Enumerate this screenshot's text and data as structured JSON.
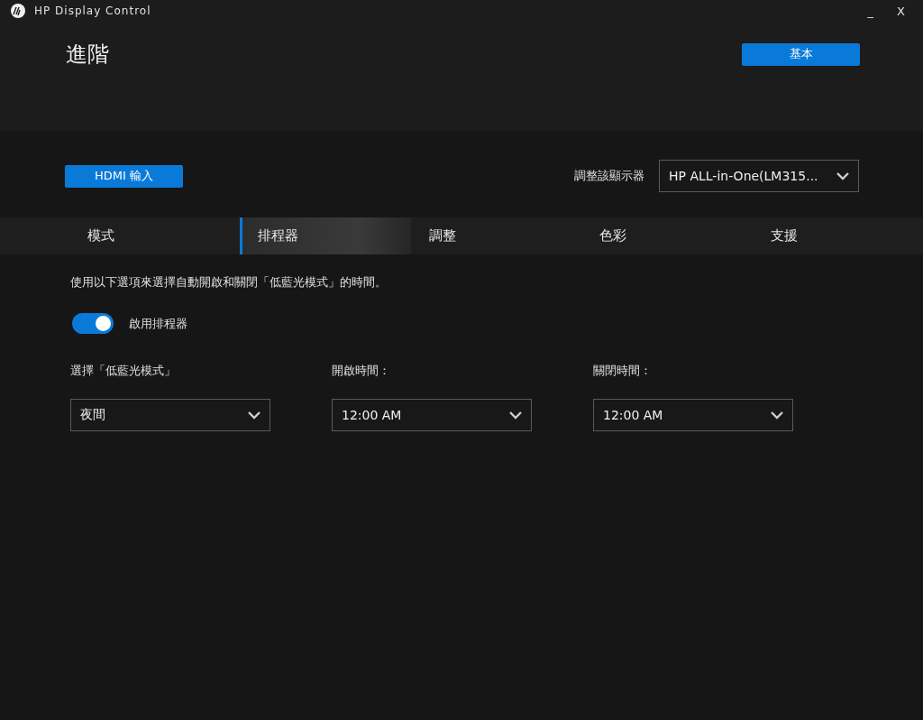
{
  "window": {
    "title": "HP Display Control",
    "minimize": "_",
    "close": "X"
  },
  "header": {
    "title": "進階",
    "mode_button": "基本"
  },
  "input_button": "HDMI 輸入",
  "monitor": {
    "label": "調整該顯示器",
    "value": "HP ALL-in-One(LM315..."
  },
  "tabs": [
    {
      "label": "模式",
      "selected": false
    },
    {
      "label": "排程器",
      "selected": true
    },
    {
      "label": "調整",
      "selected": false
    },
    {
      "label": "色彩",
      "selected": false
    },
    {
      "label": "支援",
      "selected": false
    }
  ],
  "description": "使用以下選項來選擇自動開啟和關閉「低藍光模式」的時間。",
  "scheduler_toggle": {
    "label": "啟用排程器",
    "on": true
  },
  "fields": [
    {
      "label": "選擇「低藍光模式」",
      "value": "夜間"
    },
    {
      "label": "開啟時間：",
      "value": "12:00 AM"
    },
    {
      "label": "關閉時間：",
      "value": "12:00 AM"
    }
  ]
}
